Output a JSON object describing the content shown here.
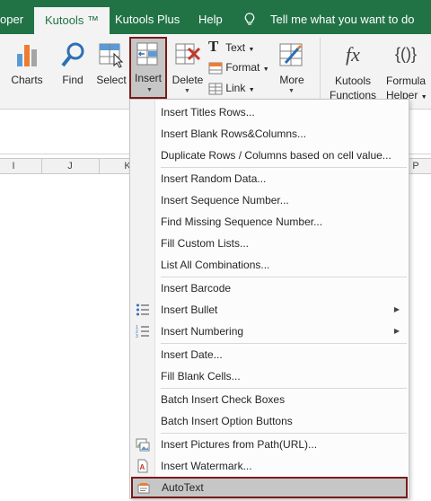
{
  "tabs": {
    "developer_partial": "oper",
    "kutools": "Kutools ™",
    "kutools_plus": "Kutools Plus",
    "help": "Help",
    "tell_me": "Tell me what you want to do"
  },
  "ribbon": {
    "charts": "Charts",
    "find": "Find",
    "select": "Select",
    "insert": "Insert",
    "delete": "Delete",
    "text": "Text",
    "format": "Format",
    "link": "Link",
    "more": "More",
    "kutools_functions_1": "Kutools",
    "kutools_functions_2": "Functions",
    "formula_helper_1": "Formula",
    "formula_helper_2": "Helper",
    "fx_glyph": "fx",
    "braces_glyph": "{()}"
  },
  "columns": [
    "I",
    "J",
    "K",
    "P"
  ],
  "menu": {
    "items": [
      {
        "label": "Insert Titles Rows..."
      },
      {
        "label": "Insert Blank Rows&Columns..."
      },
      {
        "label": "Duplicate Rows / Columns based on cell value..."
      },
      {
        "label": "Insert Random Data..."
      },
      {
        "label": "Insert Sequence Number..."
      },
      {
        "label": "Find Missing Sequence Number..."
      },
      {
        "label": "Fill Custom Lists..."
      },
      {
        "label": "List All Combinations..."
      },
      {
        "label": "Insert Barcode"
      },
      {
        "label": "Insert Bullet"
      },
      {
        "label": "Insert Numbering"
      },
      {
        "label": "Insert Date..."
      },
      {
        "label": "Fill Blank Cells..."
      },
      {
        "label": "Batch Insert Check Boxes"
      },
      {
        "label": "Batch Insert Option Buttons"
      },
      {
        "label": "Insert Pictures from Path(URL)..."
      },
      {
        "label": "Insert Watermark..."
      },
      {
        "label": "AutoText"
      }
    ]
  },
  "colors": {
    "tab_green": "#217346",
    "ribbon_bg": "#f3f3f3",
    "highlight_bg": "#c6c6c6",
    "highlight_border": "#7b1a1a",
    "icon_blue": "#2f6fb5",
    "icon_red": "#c0392b"
  }
}
